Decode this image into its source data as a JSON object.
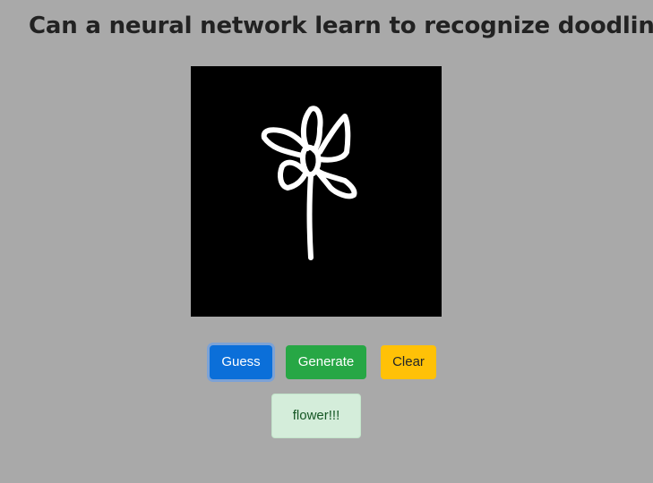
{
  "page": {
    "title": "Can a neural network learn to recognize doodling?"
  },
  "canvas": {
    "background": "#000000",
    "stroke_color": "#ffffff",
    "drawing": "flower-doodle-icon"
  },
  "buttons": {
    "guess": {
      "label": "Guess",
      "color": "#0b6fd9"
    },
    "generate": {
      "label": "Generate",
      "color": "#27a745"
    },
    "clear": {
      "label": "Clear",
      "color": "#ffc107"
    }
  },
  "result": {
    "text": "flower!!!",
    "background": "#d4edda"
  }
}
